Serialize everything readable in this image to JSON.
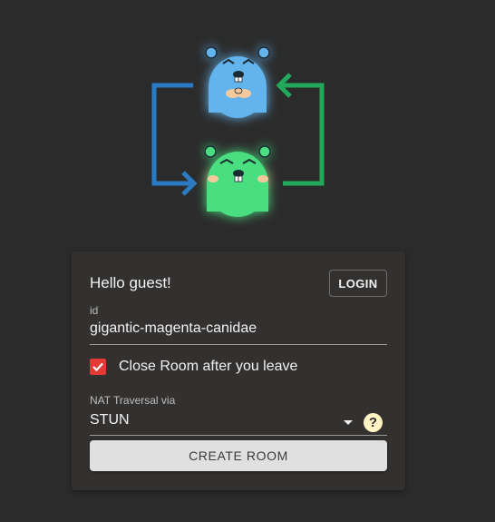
{
  "card": {
    "greeting": "Hello guest!",
    "login_label": "LOGIN",
    "id_label": "id",
    "id_value": "gigantic-magenta-canidae",
    "close_room_label": "Close Room after you leave",
    "close_room_checked": true,
    "nat_label": "NAT Traversal via",
    "nat_value": "STUN",
    "help_symbol": "?",
    "create_room_label": "CREATE ROOM"
  },
  "icons": {
    "hero_top": "blue-gopher-icon",
    "hero_bottom": "green-gopher-icon",
    "arrow_left": "blue-arrow-icon",
    "arrow_right": "green-arrow-icon"
  },
  "colors": {
    "background": "#2b2b2b",
    "card": "#333130",
    "checkbox": "#e53935",
    "blue_gopher": "#63b3ed",
    "green_gopher": "#4ade80"
  }
}
